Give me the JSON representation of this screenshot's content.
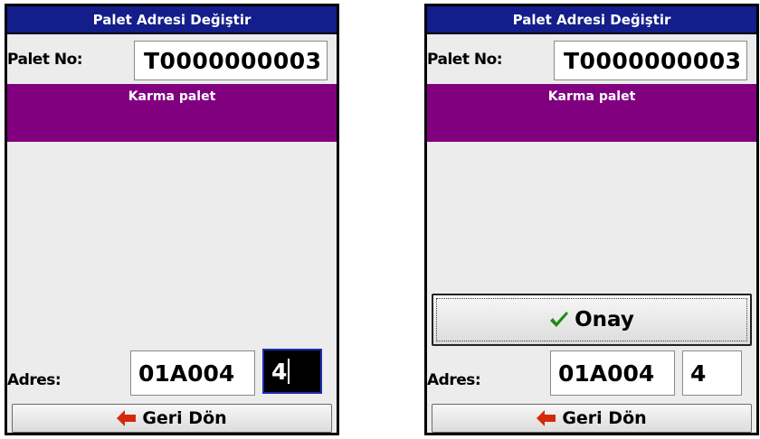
{
  "screens": [
    {
      "title": "Palet Adresi Değiştir",
      "palet_label": "Palet No:",
      "palet_value": "T0000000003",
      "band_text": "Karma palet",
      "adres_label": "Adres:",
      "adres_value": "01A004",
      "adres_seq": "4",
      "back_label": "Geri Dön"
    },
    {
      "title": "Palet Adresi Değiştir",
      "palet_label": "Palet No:",
      "palet_value": "T0000000003",
      "band_text": "Karma palet",
      "confirm_label": "Onay",
      "adres_label": "Adres:",
      "adres_value": "01A004",
      "adres_seq": "4",
      "back_label": "Geri Dön"
    }
  ],
  "colors": {
    "title_bg": "#131e8a",
    "band_bg": "#800080",
    "screen_bg": "#ececec"
  },
  "icons": {
    "back": "left-arrow-icon",
    "confirm": "check-icon"
  }
}
